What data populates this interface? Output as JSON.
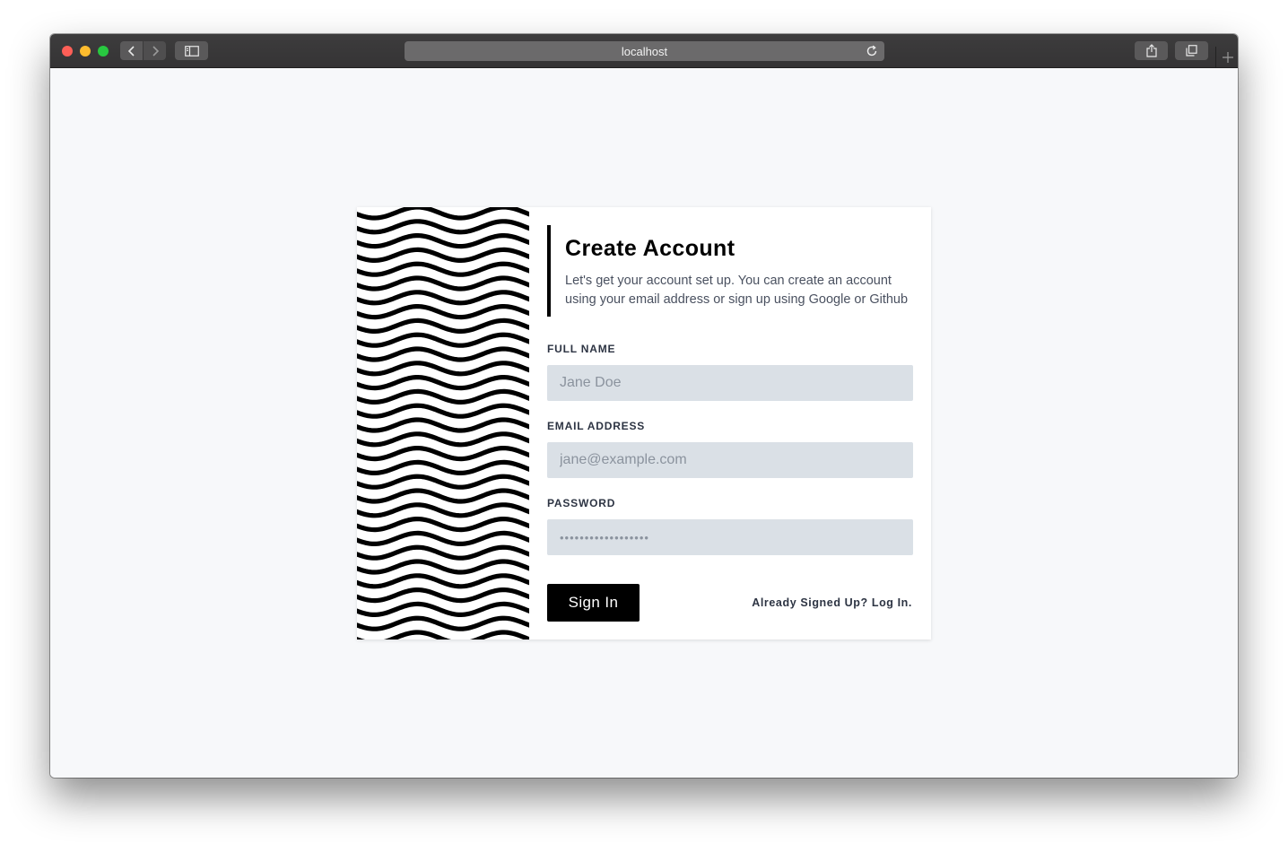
{
  "browser": {
    "url": "localhost"
  },
  "form": {
    "title": "Create Account",
    "subtitle": "Let's get your account set up. You can create an account using your email address or sign up using Google or Github",
    "fields": [
      {
        "label": "FULL NAME",
        "placeholder": "Jane Doe",
        "type": "text"
      },
      {
        "label": "EMAIL ADDRESS",
        "placeholder": "jane@example.com",
        "type": "email"
      },
      {
        "label": "PASSWORD",
        "placeholder": "••••••••••••••••••",
        "type": "password"
      }
    ],
    "submit_label": "Sign In",
    "login_link": "Already Signed Up? Log In."
  },
  "colors": {
    "accent": "#000000",
    "input_bg": "#dae0e6",
    "page_bg": "#f7f8fa",
    "label_text": "#2d3443"
  },
  "icons": {
    "back": "chevron-left-icon",
    "forward": "chevron-right-icon",
    "sidebar": "sidebar-icon",
    "reload": "reload-icon",
    "share": "share-icon",
    "tabs": "tabs-overview-icon",
    "new_tab": "plus-icon"
  }
}
